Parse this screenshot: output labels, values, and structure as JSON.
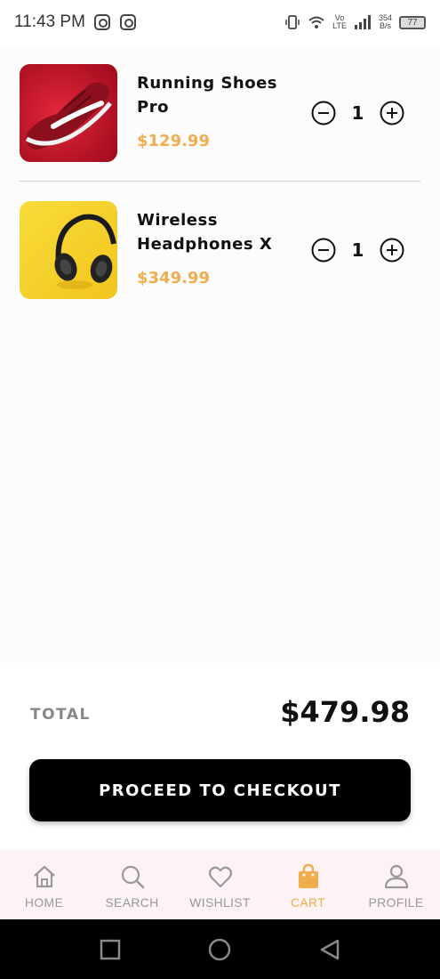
{
  "status_bar": {
    "time": "11:43 PM",
    "network_volte": "Vo",
    "network_lte": "LTE",
    "data_speed_value": "354",
    "data_speed_unit": "B/s",
    "battery": "77"
  },
  "cart": {
    "items": [
      {
        "name": "Running Shoes Pro",
        "price": "$129.99",
        "quantity": "1",
        "image_icon": "red-running-shoe"
      },
      {
        "name": "Wireless Headphones X",
        "price": "$349.99",
        "quantity": "1",
        "image_icon": "black-headphones"
      }
    ]
  },
  "summary": {
    "total_label": "TOTAL",
    "total_value": "$479.98",
    "checkout_label": "PROCEED TO CHECKOUT"
  },
  "bottom_nav": {
    "items": [
      {
        "label": "HOME",
        "icon": "home-icon",
        "active": false
      },
      {
        "label": "SEARCH",
        "icon": "search-icon",
        "active": false
      },
      {
        "label": "WISHLIST",
        "icon": "heart-icon",
        "active": false
      },
      {
        "label": "CART",
        "icon": "shopping-bag-icon",
        "active": true
      },
      {
        "label": "PROFILE",
        "icon": "user-icon",
        "active": false
      }
    ]
  },
  "colors": {
    "accent": "#f0ad4e",
    "checkout_button": "#000000",
    "nav_background": "#fdf3f4"
  }
}
